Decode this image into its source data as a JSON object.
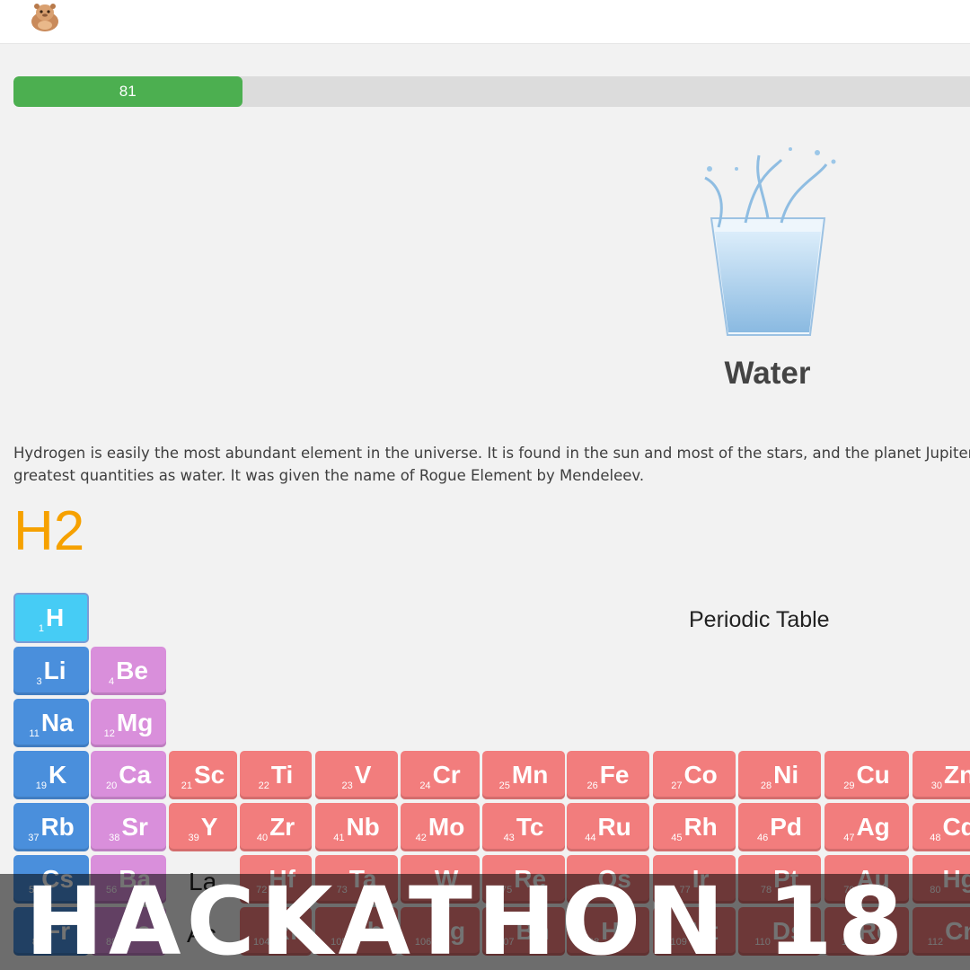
{
  "progress": {
    "value_label": "81",
    "fraction": 0.239
  },
  "compound": {
    "name": "Water",
    "formula": "H2"
  },
  "description": [
    "Hydrogen is easily the most abundant element in the universe. It is found in the sun and most of the stars, and the planet Jupiter is",
    "greatest quantities as water. It was given the name of Rogue Element by Mendeleev."
  ],
  "periodic_table": {
    "title": "Periodic Table",
    "elements": [
      {
        "n": "1",
        "s": "H"
      },
      {
        "n": "3",
        "s": "Li"
      },
      {
        "n": "4",
        "s": "Be"
      },
      {
        "n": "11",
        "s": "Na"
      },
      {
        "n": "12",
        "s": "Mg"
      },
      {
        "n": "19",
        "s": "K"
      },
      {
        "n": "20",
        "s": "Ca"
      },
      {
        "n": "21",
        "s": "Sc"
      },
      {
        "n": "22",
        "s": "Ti"
      },
      {
        "n": "23",
        "s": "V"
      },
      {
        "n": "24",
        "s": "Cr"
      },
      {
        "n": "25",
        "s": "Mn"
      },
      {
        "n": "26",
        "s": "Fe"
      },
      {
        "n": "27",
        "s": "Co"
      },
      {
        "n": "28",
        "s": "Ni"
      },
      {
        "n": "29",
        "s": "Cu"
      },
      {
        "n": "30",
        "s": "Zn"
      },
      {
        "n": "37",
        "s": "Rb"
      },
      {
        "n": "38",
        "s": "Sr"
      },
      {
        "n": "39",
        "s": "Y"
      },
      {
        "n": "40",
        "s": "Zr"
      },
      {
        "n": "41",
        "s": "Nb"
      },
      {
        "n": "42",
        "s": "Mo"
      },
      {
        "n": "43",
        "s": "Tc"
      },
      {
        "n": "44",
        "s": "Ru"
      },
      {
        "n": "45",
        "s": "Rh"
      },
      {
        "n": "46",
        "s": "Pd"
      },
      {
        "n": "47",
        "s": "Ag"
      },
      {
        "n": "48",
        "s": "Cd"
      },
      {
        "n": "55",
        "s": "Cs"
      },
      {
        "n": "56",
        "s": "Ba"
      },
      {
        "n": "72",
        "s": "Hf"
      },
      {
        "n": "73",
        "s": "Ta"
      },
      {
        "n": "74",
        "s": "W"
      },
      {
        "n": "75",
        "s": "Re"
      },
      {
        "n": "76",
        "s": "Os"
      },
      {
        "n": "77",
        "s": "Ir"
      },
      {
        "n": "78",
        "s": "Pt"
      },
      {
        "n": "79",
        "s": "Au"
      },
      {
        "n": "80",
        "s": "Hg"
      },
      {
        "n": "87",
        "s": "Fr"
      },
      {
        "n": "88",
        "s": "Ra"
      },
      {
        "n": "104",
        "s": "Rf"
      },
      {
        "n": "105",
        "s": "Db"
      },
      {
        "n": "106",
        "s": "Sg"
      },
      {
        "n": "107",
        "s": "Bh"
      },
      {
        "n": "108",
        "s": "Hs"
      },
      {
        "n": "109",
        "s": "Mt"
      },
      {
        "n": "110",
        "s": "Ds"
      },
      {
        "n": "111",
        "s": "Rg"
      },
      {
        "n": "112",
        "s": "Cn"
      }
    ],
    "lanthanide_label": "La",
    "actinide_label": "Ac"
  },
  "banner": {
    "text": "HACKATHON 18"
  }
}
